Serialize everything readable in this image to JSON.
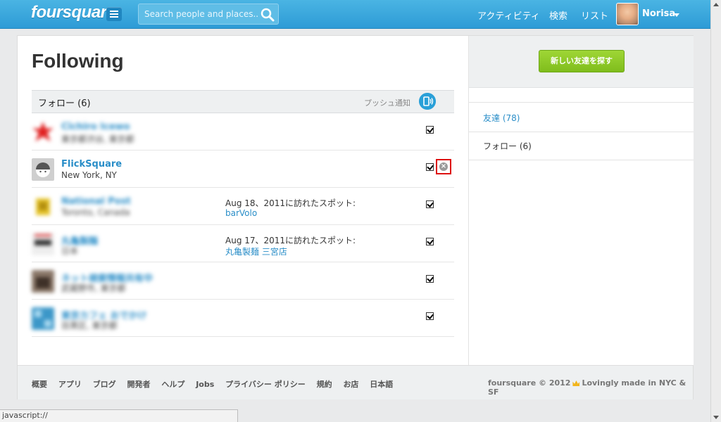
{
  "header": {
    "logo": "foursquare",
    "search_placeholder": "Search people and places...",
    "nav": [
      "アクティビティ",
      "検索",
      "リスト"
    ],
    "user_name": "Norisa"
  },
  "page": {
    "title": "Following",
    "section_title": "フォロー (6)",
    "push_label": "プッシュ通知"
  },
  "rows": [
    {
      "name": "Cîchiro Icewo",
      "location": "東京都渋谷, 東京都",
      "visit": "",
      "venue": "",
      "blurred": true,
      "pic_color": "#e02020"
    },
    {
      "name": "FlickSquare",
      "location": "New York, NY",
      "visit": "",
      "venue": "",
      "blurred": false,
      "pic_color": "#cfcfcf"
    },
    {
      "name": "National Post",
      "location": "Toronto, Canada",
      "visit": "Aug 18、2011に訪れたスポット:",
      "venue": "barVolo",
      "blurred": true,
      "pic_color": "#e6c42a"
    },
    {
      "name": "丸亀製麺",
      "location": "日本",
      "visit": "Aug 17、2011に訪れたスポット:",
      "venue": "丸亀製麺 三宮店",
      "blurred": true,
      "pic_color": "#d9d9d9"
    },
    {
      "name": "ネット検索情報共有中",
      "location": "武蔵野市, 東京都",
      "visit": "",
      "venue": "",
      "blurred": true,
      "pic_color": "#6b5a50"
    },
    {
      "name": "東京カフェ おでかけ",
      "location": "目黒区, 東京都",
      "visit": "",
      "venue": "",
      "blurred": true,
      "pic_color": "#3c97c8"
    }
  ],
  "sidebar": {
    "find_button": "新しい友達を探す",
    "friends": "友達 (78)",
    "following": "フォロー (6)"
  },
  "footer": {
    "links": [
      "概要",
      "アプリ",
      "ブログ",
      "開発者",
      "ヘルプ",
      "Jobs",
      "プライバシー ポリシー",
      "規約",
      "お店",
      "日本語"
    ],
    "copyright_left": "foursquare © 2012",
    "copyright_right": "Lovingly made in NYC & SF"
  },
  "status_bar": "javascript://",
  "colors": {
    "brand": "#2d9bd6",
    "link": "#2a8ec8",
    "green_button": "#8bc926"
  }
}
